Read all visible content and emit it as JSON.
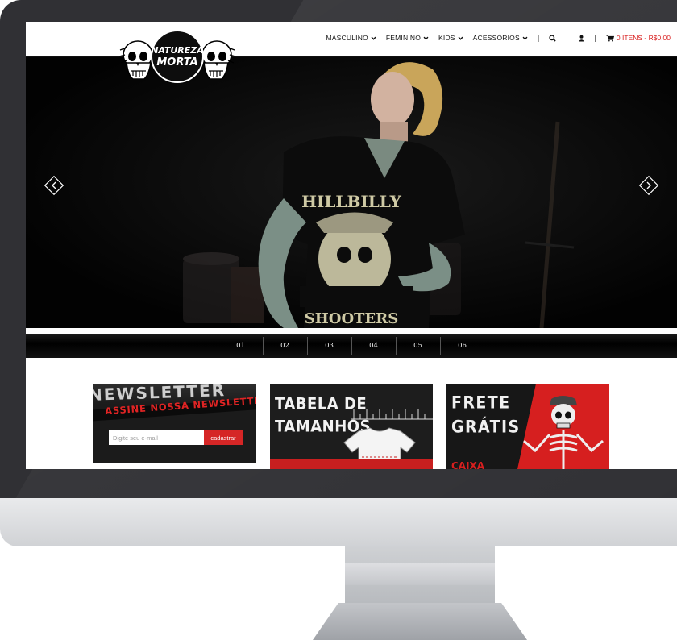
{
  "brand": {
    "logo_line1": "NATUREZA",
    "logo_line2": "MORTA"
  },
  "nav": {
    "items": [
      {
        "label": "MASCULINO"
      },
      {
        "label": "FEMININO"
      },
      {
        "label": "KIDS"
      },
      {
        "label": "ACESSÓRIOS"
      }
    ],
    "cart_label": "0 ITENS - R$0,00"
  },
  "hero": {
    "shirt_text_top": "HILLBILLY",
    "shirt_text_bottom": "SHOOTERS"
  },
  "slider_pages": [
    "01",
    "02",
    "03",
    "04",
    "05",
    "06"
  ],
  "banners": {
    "newsletter": {
      "ghost_text": "NEWSLETTER",
      "title": "ASSINE NOSSA NEWSLETTER",
      "input_placeholder": "Digite seu e-mail",
      "button_label": "cadastrar"
    },
    "sizes": {
      "line1": "TABELA DE",
      "line2": "TAMANHOS"
    },
    "shipping": {
      "line1": "FRETE",
      "line2": "GRÁTIS",
      "partial": "CAIXA"
    }
  },
  "colors": {
    "accent": "#d92020",
    "nav_text": "#111111",
    "hero_bg": "#050505"
  }
}
